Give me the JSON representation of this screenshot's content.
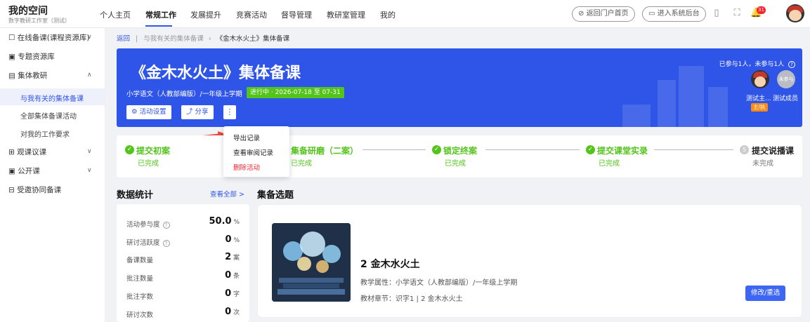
{
  "brand": {
    "title": "我的空间",
    "subtitle": "数字教研工作室（测试）"
  },
  "nav": [
    "个人主页",
    "常规工作",
    "发展提升",
    "竞赛活动",
    "督导管理",
    "教研室管理",
    "我的"
  ],
  "header_actions": {
    "portal": "返回门户首页",
    "backend": "进入系统后台",
    "notif_count": "31"
  },
  "sidebar": {
    "items": [
      {
        "label": "在线备课(课程资源库)"
      },
      {
        "label": "专题资源库"
      },
      {
        "label": "集体教研"
      },
      {
        "label": "与我有关的集体备课"
      },
      {
        "label": "全部集体备课活动"
      },
      {
        "label": "对我的工作要求"
      },
      {
        "label": "观课议课"
      },
      {
        "label": "公开课"
      },
      {
        "label": "受邀协同备课"
      }
    ]
  },
  "breadcrumb": {
    "back": "返回",
    "parent": "与我有关的集体备课",
    "current": "《金木水火土》集体备课"
  },
  "banner": {
    "title": "《金木水火土》集体备课",
    "meta": "小学语文（人教部编版）/一年级上学期",
    "status_tag": "进行中 · 2026-07-18 至 07-31",
    "settings_btn": "活动设置",
    "share_btn": "分享",
    "more_btn": "⋮",
    "participation": "已参与1人，未参与1人",
    "members": [
      {
        "name": "测试主..."
      },
      {
        "name": "测试成员"
      }
    ],
    "role": "主/执",
    "avatar2_text": "未参与"
  },
  "menu": {
    "items": [
      "导出记录",
      "查看审阅记录",
      "删除活动"
    ]
  },
  "steps": [
    {
      "title": "提交初案",
      "status": "已完成"
    },
    {
      "title": "集备研磨（二案）",
      "status": "已完成"
    },
    {
      "title": "锁定终案",
      "status": "已完成"
    },
    {
      "title": "提交课堂实录",
      "status": "已完成"
    },
    {
      "num": "5",
      "title": "提交说播课",
      "status": "未完成"
    }
  ],
  "stats": {
    "title": "数据统计",
    "view_all": "查看全部 >",
    "rows": [
      {
        "label": "活动参与度",
        "value": "50.0",
        "unit": "%"
      },
      {
        "label": "研讨活跃度",
        "value": "0",
        "unit": "%"
      },
      {
        "label": "备课数量",
        "value": "2",
        "unit": "案"
      },
      {
        "label": "批注数量",
        "value": "0",
        "unit": "条"
      },
      {
        "label": "批注字数",
        "value": "0",
        "unit": "字"
      },
      {
        "label": "研讨次数",
        "value": "0",
        "unit": "次"
      }
    ]
  },
  "topic": {
    "section_title": "集备选题",
    "title": "2 金木水火土",
    "attr": "教学属性：小学语文（人教部编版）/一年级上学期",
    "chapter": "教材章节：识字1 | 2 金木水火土",
    "button": "修改/重选"
  }
}
